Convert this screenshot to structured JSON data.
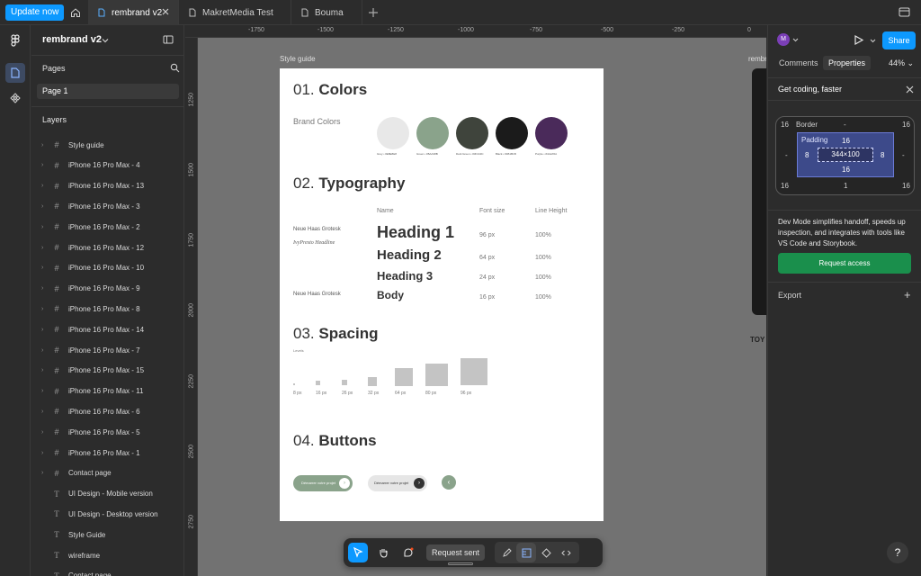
{
  "topbar": {
    "update_label": "Update now",
    "tabs": [
      {
        "label": "rembrand v2"
      },
      {
        "label": "MakretMedia Test"
      },
      {
        "label": "Bouma"
      }
    ]
  },
  "left_panel": {
    "project": "rembrand v2",
    "pages_title": "Pages",
    "current_page": "Page 1",
    "layers_title": "Layers",
    "layers": [
      "Style guide",
      "iPhone 16 Pro Max - 4",
      "iPhone 16 Pro Max - 13",
      "iPhone 16 Pro Max - 3",
      "iPhone 16 Pro Max - 2",
      "iPhone 16 Pro Max - 12",
      "iPhone 16 Pro Max - 10",
      "iPhone 16 Pro Max - 9",
      "iPhone 16 Pro Max - 8",
      "iPhone 16 Pro Max - 14",
      "iPhone 16 Pro Max - 7",
      "iPhone 16 Pro Max - 15",
      "iPhone 16 Pro Max - 11",
      "iPhone 16 Pro Max - 6",
      "iPhone 16 Pro Max - 5",
      "iPhone 16 Pro Max - 1",
      "Contact page",
      "UI Design - Mobile version",
      "UI Design - Desktop version",
      "Style Guide",
      "wireframe",
      "Contact page"
    ]
  },
  "rulers": {
    "top": [
      "-1750",
      "-1500",
      "-1250",
      "-1000",
      "-750",
      "-500",
      "-250",
      "0"
    ],
    "left": [
      "1250",
      "1500",
      "1750",
      "2000",
      "2250",
      "2500",
      "2750"
    ]
  },
  "canvas": {
    "frame_label": "Style guide",
    "frame2_label": "rembr",
    "frame2_logo": "TOY",
    "colors": {
      "num": "01.",
      "title": "Colors",
      "label": "Brand Colors",
      "swatches": [
        {
          "hex": "#e8e8e8",
          "caption": "Grey • #E8E8E8"
        },
        {
          "hex": "#8aa38b",
          "caption": "Green • #8AA38B"
        },
        {
          "hex": "#3f443c",
          "caption": "Dark Green • #3F443C"
        },
        {
          "hex": "#1b1b1b",
          "caption": "Black • #1B1B1B"
        },
        {
          "hex": "#4a2a5a",
          "caption": "Purple • #4A2A5A"
        }
      ]
    },
    "typography": {
      "num": "02.",
      "title": "Typography",
      "col_name": "Name",
      "col_size": "Font size",
      "col_line": "Line Height",
      "font1": "Neue Haas Grotesk",
      "font2": "IvyPresto Headline",
      "font3": "Neue Haas Grotesk",
      "rows": [
        {
          "name": "Heading 1",
          "size": "96 px",
          "line": "100%"
        },
        {
          "name": "Heading 2",
          "size": "64 px",
          "line": "100%"
        },
        {
          "name": "Heading 3",
          "size": "24 px",
          "line": "100%"
        },
        {
          "name": "Body",
          "size": "16 px",
          "line": "100%"
        }
      ]
    },
    "spacing": {
      "num": "03.",
      "title": "Spacing",
      "levels_label": "Levels",
      "items": [
        "8 px",
        "16 px",
        "26 px",
        "32 px",
        "64 px",
        "80 px",
        "96 px"
      ]
    },
    "buttons": {
      "num": "04.",
      "title": "Buttons",
      "primary_label": "Démarrer votre projet",
      "secondary_label": "Démarrer votre projet",
      "arrow": "›",
      "back_arrow": "‹"
    }
  },
  "toolbar": {
    "request_sent": "Request sent"
  },
  "right_panel": {
    "avatar_letter": "M",
    "share": "Share",
    "tabs": [
      "Comments",
      "Properties"
    ],
    "zoom": "44%",
    "banner": "Get coding, faster",
    "box": {
      "border_label": "Border",
      "border_value": "-",
      "padding_label": "Padding",
      "outer_tl": "16",
      "outer_tr": "16",
      "outer_bl": "16",
      "outer_br": "16",
      "outer_left": "-",
      "outer_right": "-",
      "outer_bottom": "1",
      "pad_top": "16",
      "pad_left": "8",
      "pad_right": "8",
      "pad_bottom": "16",
      "size": "344×100"
    },
    "dev_text": "Dev Mode simplifies handoff, speeds up inspection, and integrates with tools like VS Code and Storybook.",
    "request_access": "Request access",
    "export": "Export",
    "export_plus": "+",
    "help": "?"
  }
}
